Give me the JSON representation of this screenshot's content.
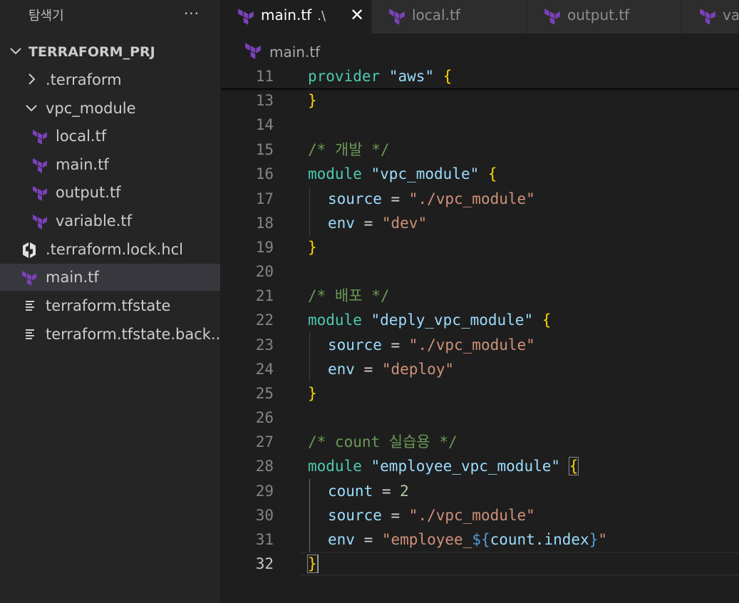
{
  "colors": {
    "terraform_purple": "#7b42bc",
    "keyword": "#4ec9b0",
    "string": "#ce9178",
    "comment": "#6a9955",
    "bracket": "#ffd700",
    "attribute": "#9cdcfe"
  },
  "sidebar": {
    "title": "탐색기",
    "more_label": "···",
    "root": "TERRAFORM_PRJ",
    "items": [
      {
        "label": ".terraform",
        "icon": "chevron-right-icon",
        "depth": 1
      },
      {
        "label": "vpc_module",
        "icon": "chevron-down-icon",
        "depth": 1
      },
      {
        "label": "local.tf",
        "icon": "terraform-icon",
        "depth": 2
      },
      {
        "label": "main.tf",
        "icon": "terraform-icon",
        "depth": 2
      },
      {
        "label": "output.tf",
        "icon": "terraform-icon",
        "depth": 2
      },
      {
        "label": "variable.tf",
        "icon": "terraform-icon",
        "depth": 2
      },
      {
        "label": ".terraform.lock.hcl",
        "icon": "hashicorp-icon",
        "depth": 1
      },
      {
        "label": "main.tf",
        "icon": "terraform-icon",
        "depth": 1,
        "selected": true
      },
      {
        "label": "terraform.tfstate",
        "icon": "file-lines-icon",
        "depth": 1
      },
      {
        "label": "terraform.tfstate.back...",
        "icon": "file-lines-icon",
        "depth": 1
      }
    ]
  },
  "tabs": [
    {
      "label": "main.tf",
      "hint": ".\\",
      "active": true,
      "close": "✕"
    },
    {
      "label": "local.tf"
    },
    {
      "label": "output.tf"
    },
    {
      "label": "va"
    }
  ],
  "breadcrumb": {
    "label": "main.tf"
  },
  "editor": {
    "sticky": {
      "num": "11",
      "text": "provider \"aws\" {"
    },
    "lines": [
      {
        "num": "13"
      },
      {
        "num": "14"
      },
      {
        "num": "15",
        "comment": "/* 개발 */"
      },
      {
        "num": "16",
        "kw": "module",
        "name": "\"vpc_module\"",
        "brace": "{"
      },
      {
        "num": "17",
        "attr": "source",
        "op": " = ",
        "value": "\"./vpc_module\""
      },
      {
        "num": "18",
        "attr": "env",
        "op": " = ",
        "value": "\"dev\""
      },
      {
        "num": "19",
        "brace": "}"
      },
      {
        "num": "20"
      },
      {
        "num": "21",
        "comment": "/* 배포 */"
      },
      {
        "num": "22",
        "kw": "module",
        "name": "\"deply_vpc_module\"",
        "brace": "{"
      },
      {
        "num": "23",
        "attr": "source",
        "op": " = ",
        "value": "\"./vpc_module\""
      },
      {
        "num": "24",
        "attr": "env",
        "op": " = ",
        "value": "\"deploy\""
      },
      {
        "num": "25",
        "brace": "}"
      },
      {
        "num": "26"
      },
      {
        "num": "27",
        "comment": "/* count 실습용 */"
      },
      {
        "num": "28",
        "kw": "module",
        "name": "\"employee_vpc_module\"",
        "brace": "{"
      },
      {
        "num": "29",
        "attr": "count",
        "op": " = ",
        "value": "2"
      },
      {
        "num": "30",
        "attr": "source",
        "op": " = ",
        "value": "\"./vpc_module\""
      },
      {
        "num": "31",
        "attr": "env",
        "op": " = ",
        "value_pre": "\"employee_",
        "interp_open": "${",
        "interp_expr": "count.index",
        "interp_close": "}",
        "value_post": "\""
      },
      {
        "num": "32",
        "brace": "}"
      }
    ],
    "line13_brace": "}",
    "sticky_kw": "provider",
    "sticky_name": "\"aws\"",
    "sticky_brace": "{"
  }
}
